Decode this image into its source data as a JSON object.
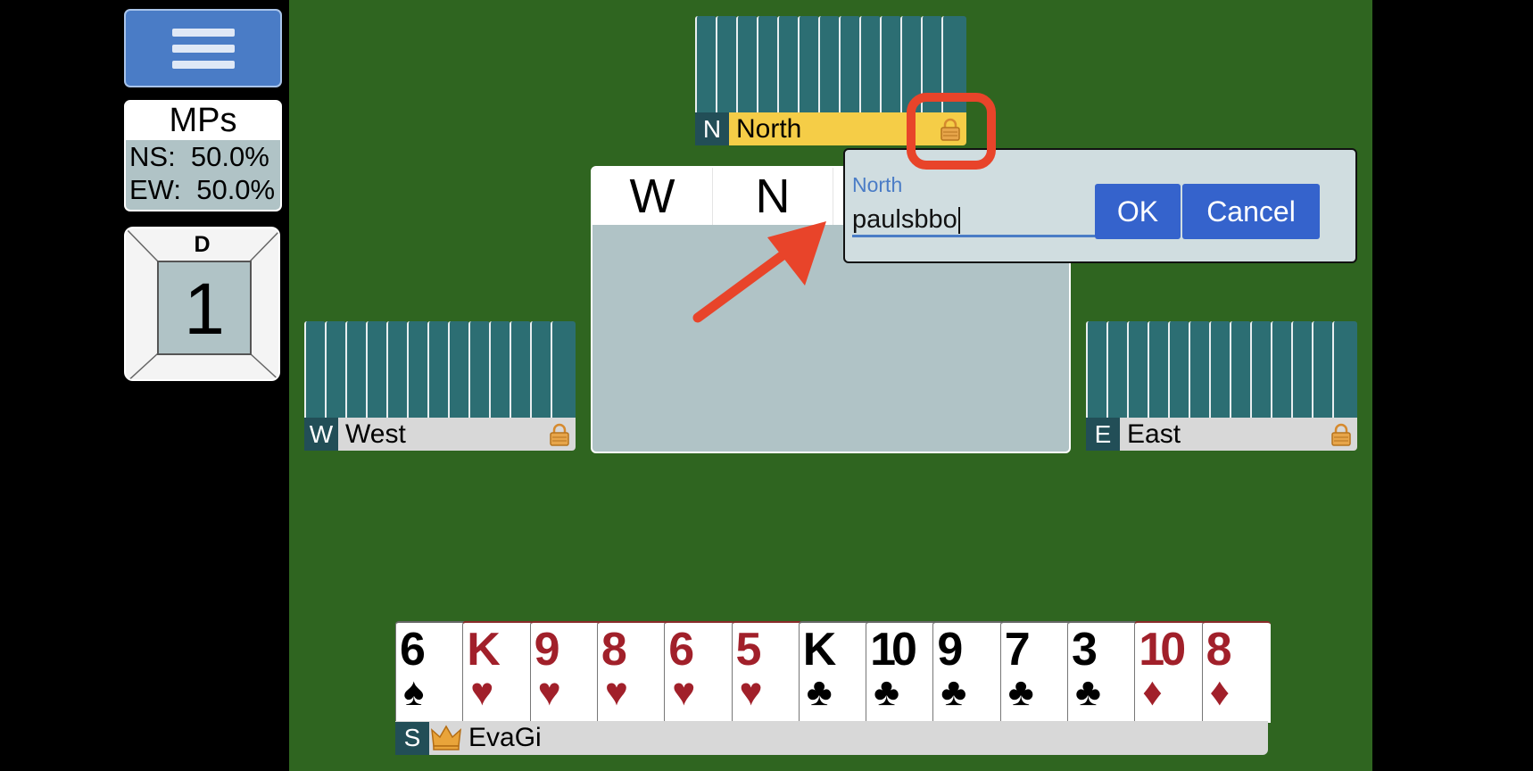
{
  "scoring": {
    "title": "MPs",
    "ns": "NS:  50.0%",
    "ew": "EW:  50.0%"
  },
  "board": {
    "dealer": "D",
    "number": "1"
  },
  "players": {
    "north": {
      "seat": "N",
      "name": "North"
    },
    "west": {
      "seat": "W",
      "name": "West"
    },
    "east": {
      "seat": "E",
      "name": "East"
    },
    "south": {
      "seat": "S",
      "name": "EvaGi"
    }
  },
  "bidding": {
    "columns": [
      "W",
      "N"
    ]
  },
  "dialog": {
    "label": "North",
    "value": "paulsbbo",
    "ok": "OK",
    "cancel": "Cancel"
  },
  "hand": [
    {
      "rank": "6",
      "suit": "♠",
      "color": "black"
    },
    {
      "rank": "K",
      "suit": "♥",
      "color": "red"
    },
    {
      "rank": "9",
      "suit": "♥",
      "color": "red"
    },
    {
      "rank": "8",
      "suit": "♥",
      "color": "red"
    },
    {
      "rank": "6",
      "suit": "♥",
      "color": "red"
    },
    {
      "rank": "5",
      "suit": "♥",
      "color": "red"
    },
    {
      "rank": "K",
      "suit": "♣",
      "color": "black"
    },
    {
      "rank": "10",
      "suit": "♣",
      "color": "black"
    },
    {
      "rank": "9",
      "suit": "♣",
      "color": "black"
    },
    {
      "rank": "7",
      "suit": "♣",
      "color": "black"
    },
    {
      "rank": "3",
      "suit": "♣",
      "color": "black"
    },
    {
      "rank": "10",
      "suit": "♦",
      "color": "red"
    },
    {
      "rank": "8",
      "suit": "♦",
      "color": "red"
    }
  ],
  "colors": {
    "felt": "#2f6520",
    "card_back": "#2c6e73",
    "active_plate": "#f5cd47",
    "button_blue": "#3563cc",
    "annotation_red": "#e8442a"
  },
  "icons": {
    "menu": "hamburger-icon",
    "lock": "padlock-icon",
    "crown": "crown-icon"
  }
}
